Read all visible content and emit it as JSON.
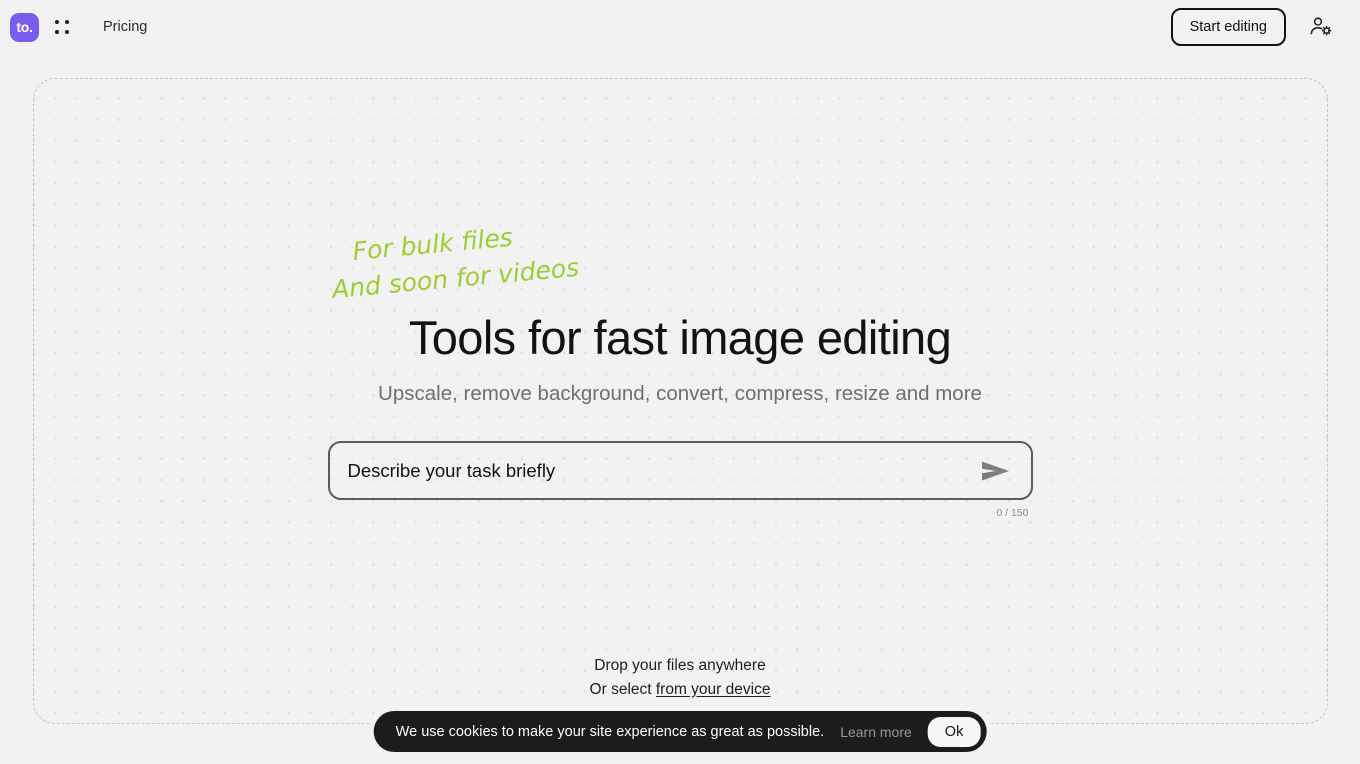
{
  "header": {
    "logo_text": "to.",
    "logo_color": "#7b5cf0",
    "apps_grid_icon": "apps-grid-icon",
    "nav": [
      {
        "label": "Pricing"
      }
    ],
    "start_editing_label": "Start editing",
    "account_icon": "user-gear-icon"
  },
  "hero": {
    "handwritten_line_1": "For bulk files",
    "handwritten_line_2": "And soon for videos",
    "handwritten_color": "#9dcd33",
    "title": "Tools for fast image editing",
    "subtitle": "Upscale, remove background, convert, compress, resize and more"
  },
  "task_input": {
    "value": "",
    "placeholder": "Describe your task briefly",
    "char_counter": "0 / 150",
    "max_length": 150,
    "send_icon": "send-arrow-icon"
  },
  "drop_zone": {
    "line_1": "Drop your files anywhere",
    "line_2_prefix": "Or select ",
    "link_label": "from your device"
  },
  "cookie_banner": {
    "message": "We use cookies to make your site experience as great as possible.",
    "learn_more_label": "Learn more",
    "ok_label": "Ok",
    "background_color": "#1c1c1c"
  }
}
